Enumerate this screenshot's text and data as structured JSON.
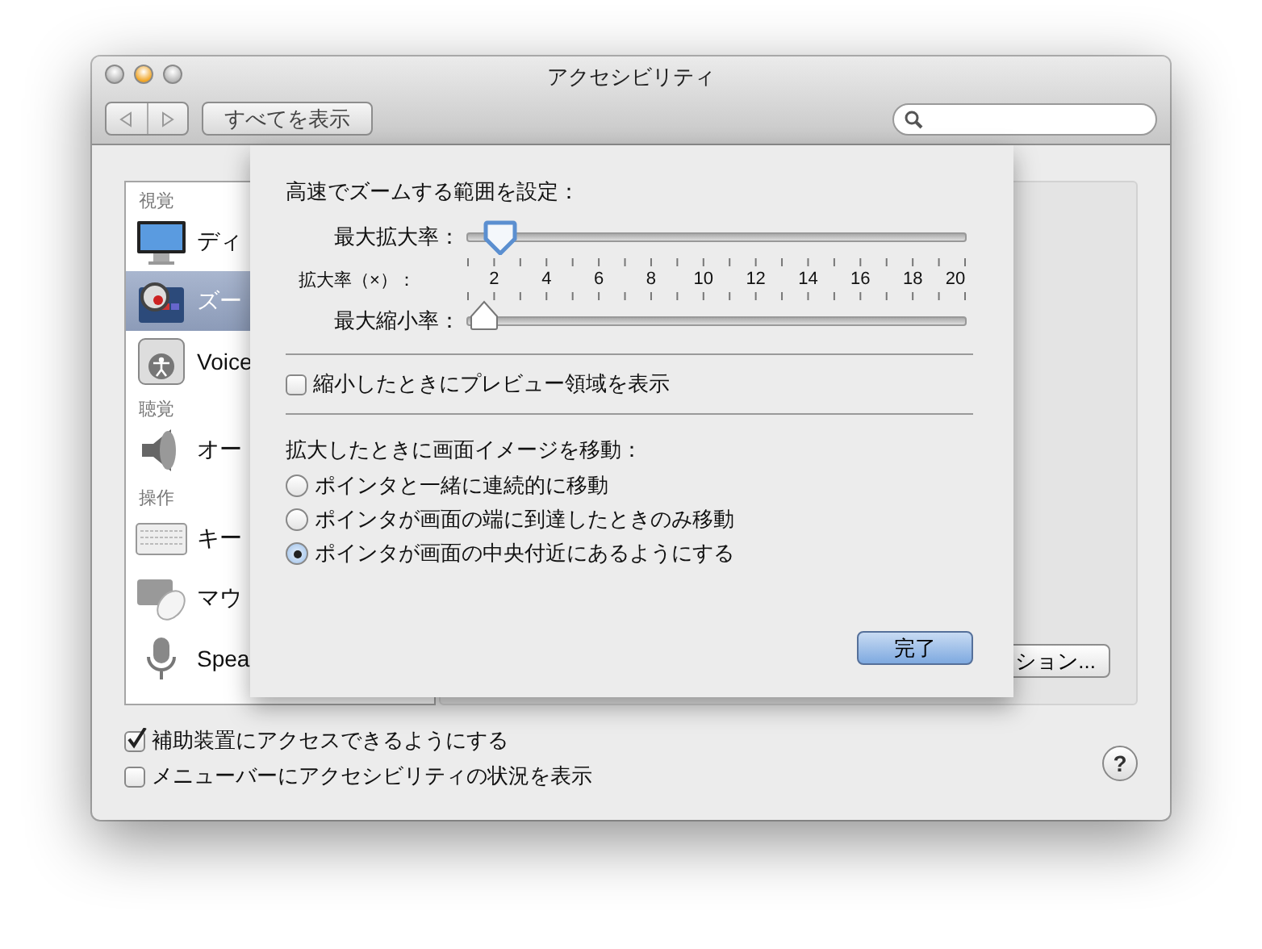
{
  "window": {
    "title": "アクセシビリティ"
  },
  "toolbar": {
    "show_all": "すべてを表示"
  },
  "sidebar": {
    "sections": [
      {
        "heading": "視覚",
        "items": [
          {
            "label": "ディ",
            "selected": false
          },
          {
            "label": "ズー",
            "selected": true
          },
          {
            "label": "Voice",
            "selected": false
          }
        ]
      },
      {
        "heading": "聴覚",
        "items": [
          {
            "label": "オー",
            "selected": false
          }
        ]
      },
      {
        "heading": "操作",
        "items": [
          {
            "label": "キー",
            "selected": false
          },
          {
            "label": "マウ",
            "selected": false
          },
          {
            "label": "Spea",
            "selected": false
          }
        ]
      }
    ]
  },
  "options_button": {
    "label": "ション..."
  },
  "sheet": {
    "title": "高速でズームする範囲を設定：",
    "max_slider": {
      "label": "最大拡大率：",
      "level": 0.068,
      "focused": true
    },
    "scale": {
      "label": "拡大率（×）：",
      "ticks": [
        "2",
        "4",
        "6",
        "8",
        "10",
        "12",
        "14",
        "16",
        "18",
        "20"
      ]
    },
    "min_slider": {
      "label": "最大縮小率：",
      "level": 0,
      "focused": false
    },
    "preview_checkbox": {
      "label": "縮小したときにプレビュー領域を表示",
      "checked": false
    },
    "move_title": "拡大したときに画面イメージを移動：",
    "move_options": [
      {
        "label": "ポインタと一緒に連続的に移動",
        "selected": false
      },
      {
        "label": "ポインタが画面の端に到達したときのみ移動",
        "selected": false
      },
      {
        "label": "ポインタが画面の中央付近にあるようにする",
        "selected": true
      }
    ],
    "done_button": "完了"
  },
  "footer": {
    "checkboxes": [
      {
        "label": "補助装置にアクセスできるようにする",
        "checked": true
      },
      {
        "label": "メニューバーにアクセシビリティの状況を表示",
        "checked": false
      }
    ],
    "help": "?"
  }
}
